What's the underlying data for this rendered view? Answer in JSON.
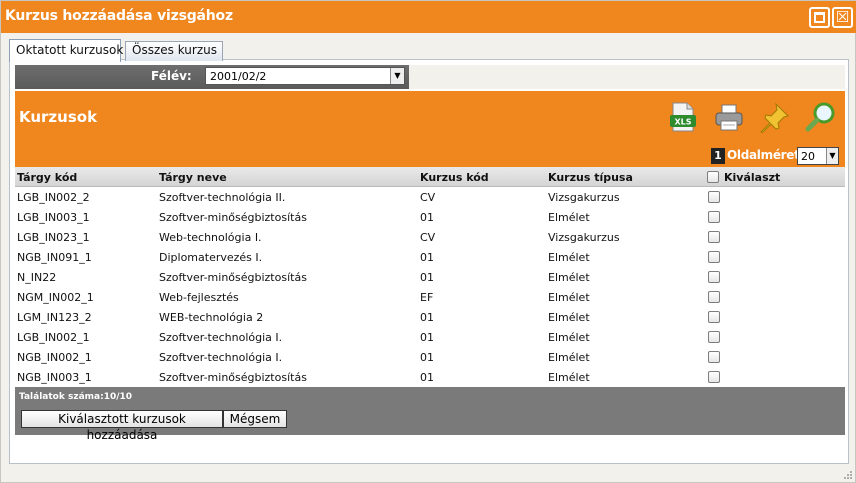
{
  "window": {
    "title": "Kurzus hozzáadása vizsgához",
    "maximize_icon": "maximize-icon",
    "close_icon": "close-icon",
    "close_glyph": "☒"
  },
  "tabs": [
    {
      "label": "Oktatott kurzusok",
      "active": true
    },
    {
      "label": "Összes kurzus",
      "active": false
    }
  ],
  "filter": {
    "label": "Félév:",
    "selected": "2001/02/2"
  },
  "section": {
    "title": "Kurzusok",
    "toolbar_icons": [
      "xls-export-icon",
      "printer-icon",
      "pin-icon",
      "search-icon"
    ],
    "xls_text": "XLS"
  },
  "pager": {
    "page": "1",
    "label": "Oldalméret",
    "page_size": "20"
  },
  "table": {
    "headers": [
      "Tárgy kód",
      "Tárgy neve",
      "Kurzus kód",
      "Kurzus típusa",
      "Kiválaszt"
    ],
    "rows": [
      [
        "LGB_IN002_2",
        "Szoftver-technológia II.",
        "CV",
        "Vizsgakurzus"
      ],
      [
        "LGB_IN003_1",
        "Szoftver-minőségbiztosítás",
        "01",
        "Elmélet"
      ],
      [
        "LGB_IN023_1",
        "Web-technológia I.",
        "CV",
        "Vizsgakurzus"
      ],
      [
        "NGB_IN091_1",
        "Diplomatervezés I.",
        "01",
        "Elmélet"
      ],
      [
        "N_IN22",
        "Szoftver-minőségbiztosítás",
        "01",
        "Elmélet"
      ],
      [
        "NGM_IN002_1",
        "Web-fejlesztés",
        "EF",
        "Elmélet"
      ],
      [
        "LGM_IN123_2",
        "WEB-technológia 2",
        "01",
        "Elmélet"
      ],
      [
        "LGB_IN002_1",
        "Szoftver-technológia I.",
        "01",
        "Elmélet"
      ],
      [
        "NGB_IN002_1",
        "Szoftver-technológia I.",
        "01",
        "Elmélet"
      ],
      [
        "NGB_IN003_1",
        "Szoftver-minőségbiztosítás",
        "01",
        "Elmélet"
      ]
    ]
  },
  "footer": {
    "count": "Találatok száma:10/10",
    "add_button": "Kiválasztott kurzusok hozzáadása",
    "cancel_button": "Mégsem"
  },
  "colors": {
    "accent": "#f0861e",
    "bar": "#7a7a7a"
  }
}
